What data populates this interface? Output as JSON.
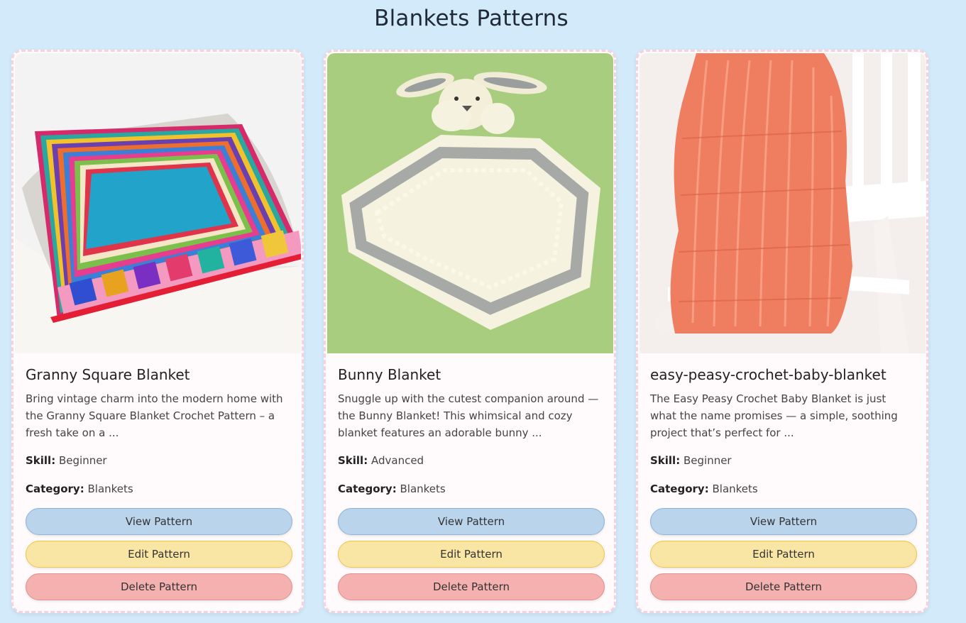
{
  "page": {
    "title": "Blankets Patterns"
  },
  "labels": {
    "skill": "Skill:",
    "category": "Category:"
  },
  "buttons": {
    "view": "View Pattern",
    "edit": "Edit Pattern",
    "delete": "Delete Pattern"
  },
  "cards": [
    {
      "title": "Granny Square Blanket",
      "description": "Bring vintage charm into the modern home with the Granny Square Blanket Crochet Pattern – a fresh take on a ...",
      "skill": "Beginner",
      "category": "Blankets",
      "image": "granny-square-blanket-photo"
    },
    {
      "title": "Bunny Blanket",
      "description": "Snuggle up with the cutest companion around — the Bunny Blanket! This whimsical and cozy blanket features an adorable bunny ...",
      "skill": "Advanced",
      "category": "Blankets",
      "image": "bunny-blanket-photo"
    },
    {
      "title": "easy-peasy-crochet-baby-blanket",
      "description": "The Easy Peasy Crochet Baby Blanket is just what the name promises — a simple, soothing project that’s perfect for ...",
      "skill": "Beginner",
      "category": "Blankets",
      "image": "orange-baby-blanket-photo"
    }
  ],
  "colors": {
    "background": "#d3eafa",
    "card_border": "#f6d3dc",
    "view_button": "#bad4ec",
    "edit_button": "#f9e5a4",
    "delete_button": "#f5b0b0"
  }
}
